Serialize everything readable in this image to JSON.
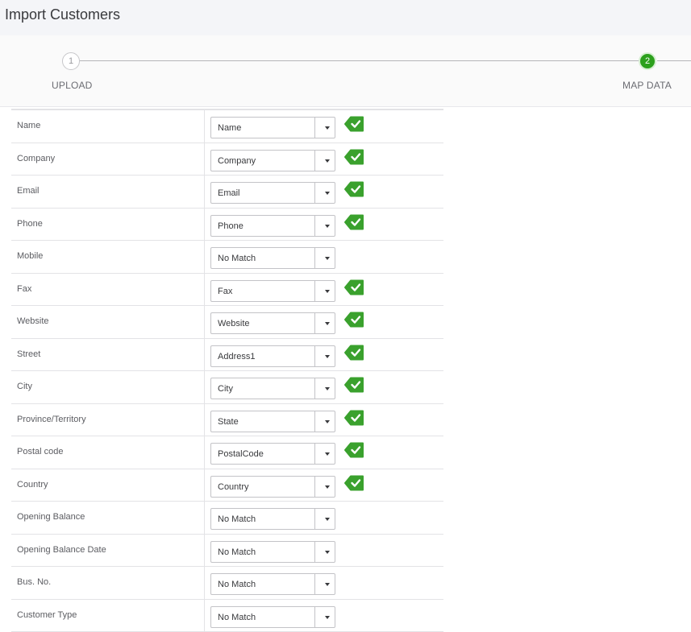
{
  "header": {
    "title": "Import Customers"
  },
  "stepper": {
    "steps": [
      {
        "number": "1",
        "label": "UPLOAD"
      },
      {
        "number": "2",
        "label": "MAP DATA"
      }
    ]
  },
  "colors": {
    "accent": "#2ca01c",
    "check": "#3aa12d"
  },
  "mapping": {
    "rows": [
      {
        "label": "Name",
        "value": "Name",
        "matched": true
      },
      {
        "label": "Company",
        "value": "Company",
        "matched": true
      },
      {
        "label": "Email",
        "value": "Email",
        "matched": true
      },
      {
        "label": "Phone",
        "value": "Phone",
        "matched": true
      },
      {
        "label": "Mobile",
        "value": "No Match",
        "matched": false
      },
      {
        "label": "Fax",
        "value": "Fax",
        "matched": true
      },
      {
        "label": "Website",
        "value": "Website",
        "matched": true
      },
      {
        "label": "Street",
        "value": "Address1",
        "matched": true
      },
      {
        "label": "City",
        "value": "City",
        "matched": true
      },
      {
        "label": "Province/Territory",
        "value": "State",
        "matched": true
      },
      {
        "label": "Postal code",
        "value": "PostalCode",
        "matched": true
      },
      {
        "label": "Country",
        "value": "Country",
        "matched": true
      },
      {
        "label": "Opening Balance",
        "value": "No Match",
        "matched": false
      },
      {
        "label": "Opening Balance Date",
        "value": "No Match",
        "matched": false
      },
      {
        "label": "Bus. No.",
        "value": "No Match",
        "matched": false
      },
      {
        "label": "Customer Type",
        "value": "No Match",
        "matched": false
      }
    ]
  }
}
